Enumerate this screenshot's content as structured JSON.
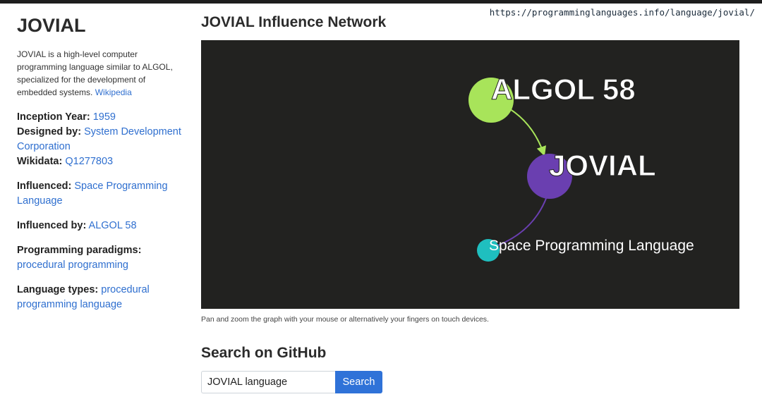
{
  "url": "https://programminglanguages.info/language/jovial/",
  "sidebar": {
    "title": "JOVIAL",
    "description": "JOVIAL is a high-level computer programming language similar to ALGOL, specialized for the development of embedded systems.",
    "wikipedia_link": "Wikipedia",
    "inception_label": "Inception Year:",
    "inception_value": "1959",
    "designed_label": "Designed by:",
    "designed_value": "System Development Corporation",
    "wikidata_label": "Wikidata:",
    "wikidata_value": "Q1277803",
    "influenced_label": "Influenced:",
    "influenced_value": "Space Programming Language",
    "influenced_by_label": "Influenced by:",
    "influenced_by_value": "ALGOL 58",
    "paradigms_label": "Programming paradigms:",
    "paradigms_value": "procedural programming",
    "types_label": "Language types:",
    "types_value": "procedural programming language"
  },
  "main": {
    "title": "JOVIAL Influence Network",
    "graph": {
      "background": "#222220",
      "nodes": [
        {
          "label": "ALGOL 58",
          "color": "#a8e45a"
        },
        {
          "label": "JOVIAL",
          "color": "#6a3fb0"
        },
        {
          "label": "Space Programming Language",
          "color": "#1fbfbf"
        }
      ],
      "edges": [
        {
          "from": "ALGOL 58",
          "to": "JOVIAL",
          "color": "#a8e45a"
        },
        {
          "from": "JOVIAL",
          "to": "Space Programming Language",
          "color": "#6a3fb0"
        }
      ]
    },
    "caption": "Pan and zoom the graph with your mouse or alternatively your fingers on touch devices.",
    "github_title": "Search on GitHub",
    "search_value": "JOVIAL language",
    "search_button": "Search"
  }
}
